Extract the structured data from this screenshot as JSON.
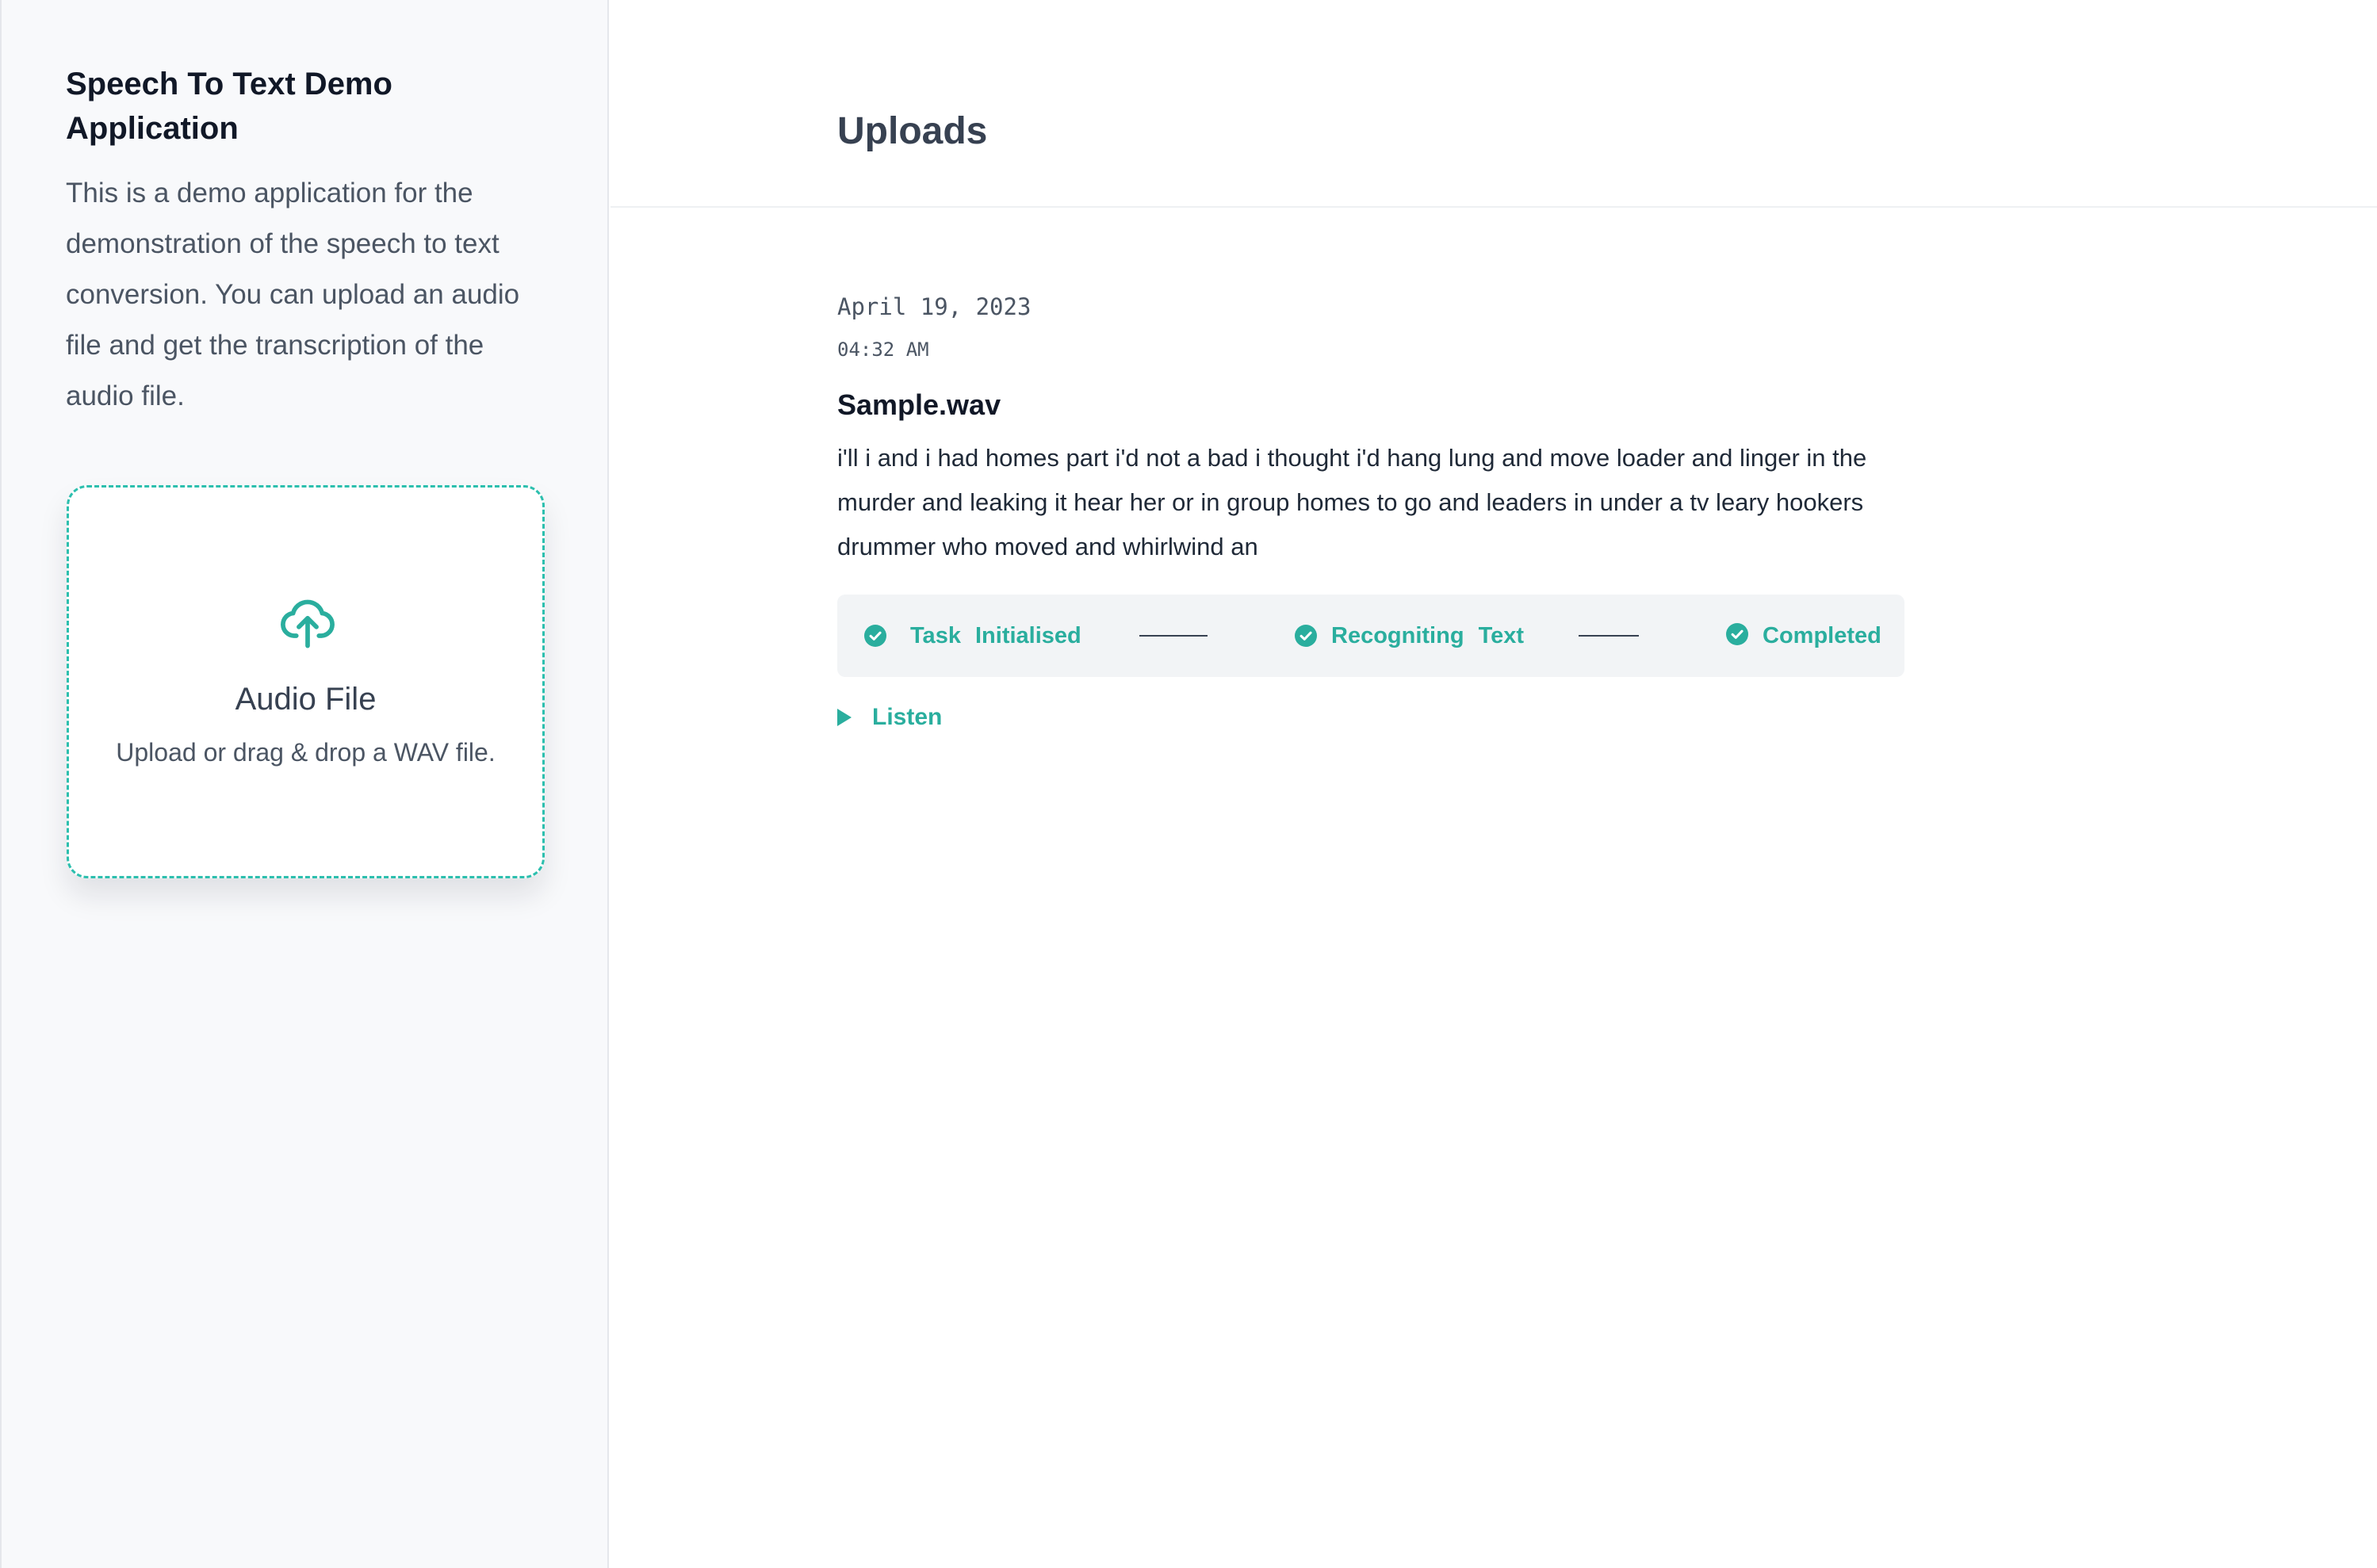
{
  "sidebar": {
    "title": "Speech To Text Demo Application",
    "description": "This is a demo application for the demonstration of the speech to text conversion. You can upload an audio file and get the transcription of the audio file.",
    "upload": {
      "icon": "cloud-upload-icon",
      "title": "Audio File",
      "hint": "Upload or drag & drop a WAV file."
    }
  },
  "main": {
    "title": "Uploads",
    "uploads": [
      {
        "date": "April 19, 2023",
        "time": "04:32 AM",
        "filename": "Sample.wav",
        "transcript": "i'll i and i had homes part i'd not a bad i thought i'd hang lung and move loader and linger in the murder and leaking it hear her or in group homes to go and leaders in under a tv leary hookers drummer who moved and whirlwind an",
        "steps": [
          {
            "label": "Task Initialised",
            "icon": "check-circle-icon",
            "status": "done"
          },
          {
            "label": "Recogniting Text",
            "icon": "check-circle-icon",
            "status": "done"
          },
          {
            "label": "Completed",
            "icon": "check-circle-icon",
            "status": "done"
          }
        ],
        "listen_label": "Listen",
        "listen_icon": "play-triangle-icon"
      }
    ]
  },
  "colors": {
    "accent": "#2aae9e",
    "upload_border": "#2cbfae",
    "sidebar_bg": "#f8f9fb",
    "progress_bg": "#f2f4f6",
    "heading": "#374151"
  }
}
